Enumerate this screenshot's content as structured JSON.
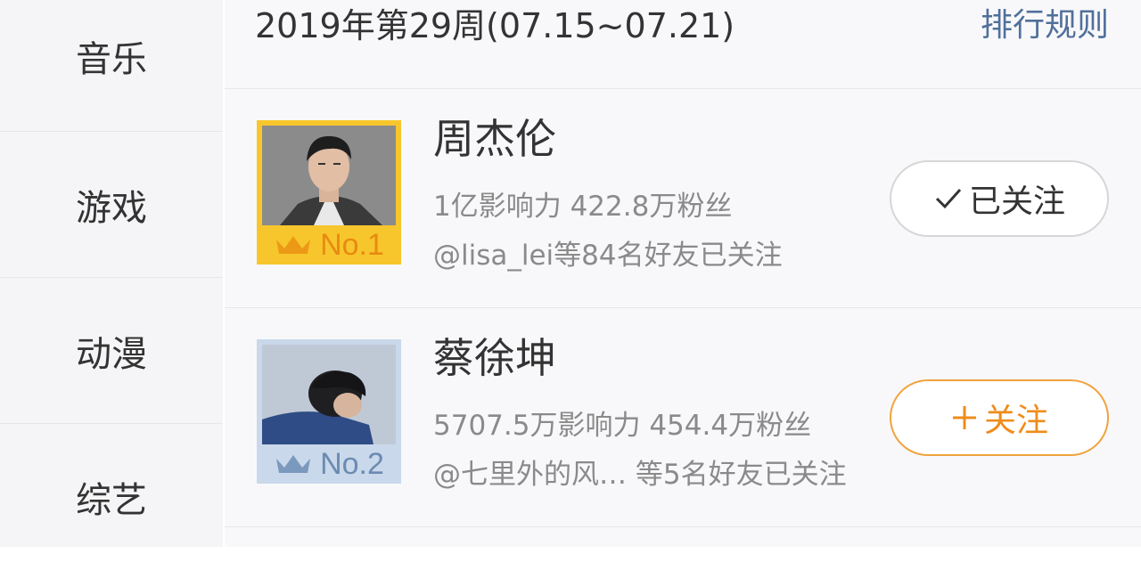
{
  "sidebar": {
    "items": [
      {
        "label": "音乐"
      },
      {
        "label": "游戏"
      },
      {
        "label": "动漫"
      },
      {
        "label": "综艺"
      }
    ]
  },
  "header": {
    "week_title": "2019年第29周(07.15~07.21)",
    "rules_link": "排行规则"
  },
  "ranking": [
    {
      "rank_label": "No.1",
      "name": "周杰伦",
      "stats": "1亿影响力 422.8万粉丝",
      "friends": "@lisa_lei等84名好友已关注",
      "follow_label": "已关注",
      "follow_icon": "check-icon",
      "badge_color": "#f7c62c",
      "crown_color": "#ec9a16"
    },
    {
      "rank_label": "No.2",
      "name": "蔡徐坤",
      "stats": "5707.5万影响力 454.4万粉丝",
      "friends": "@七里外的风…  等5名好友已关注",
      "follow_label": "关注",
      "follow_icon": "plus-icon",
      "badge_color": "#c9d8ea",
      "crown_color": "#7b98bd"
    }
  ],
  "colors": {
    "accent_orange": "#ef8c1a",
    "link_blue": "#50709a",
    "text_gray": "#8a8a8a"
  }
}
